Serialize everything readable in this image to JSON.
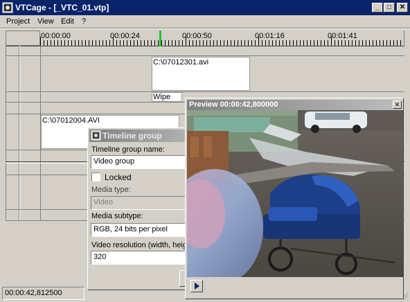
{
  "window": {
    "title": "VTCage - [_VTC_01.vtp]",
    "controls": {
      "minimize": "_",
      "maximize": "□",
      "close": "✕"
    }
  },
  "menu": {
    "items": [
      "Project",
      "View",
      "Edit",
      "?"
    ]
  },
  "timeline": {
    "ruler_labels": [
      "00:00:00",
      "00:00:24",
      "00:00:50",
      "00:01:16",
      "00:01:41"
    ],
    "clips": {
      "video_clip_1": "C:\\07012301.avi",
      "transition": "Wipe",
      "video_clip_2": "C:\\07012004.AVI"
    },
    "cursor_color": "#22c52a"
  },
  "status": {
    "time": "00:00:42,812500"
  },
  "group_dialog": {
    "title": "Timeline group",
    "name_label": "Timeline group name:",
    "name_value": "Video group",
    "locked_label": "Locked",
    "locked": false,
    "media_type_label": "Media type:",
    "media_type_value": "Video",
    "media_subtype_label": "Media subtype:",
    "media_subtype_value": "RGB, 24 bits per pixel",
    "resolution_label": "Video resolution (width, heigh",
    "resolution_width": "320"
  },
  "preview": {
    "title": "Preview 00:00:42,800000",
    "close": "✕",
    "play_icon": "play-icon"
  },
  "colors": {
    "titlebar": "#0a246a",
    "face": "#d4d0c8"
  }
}
